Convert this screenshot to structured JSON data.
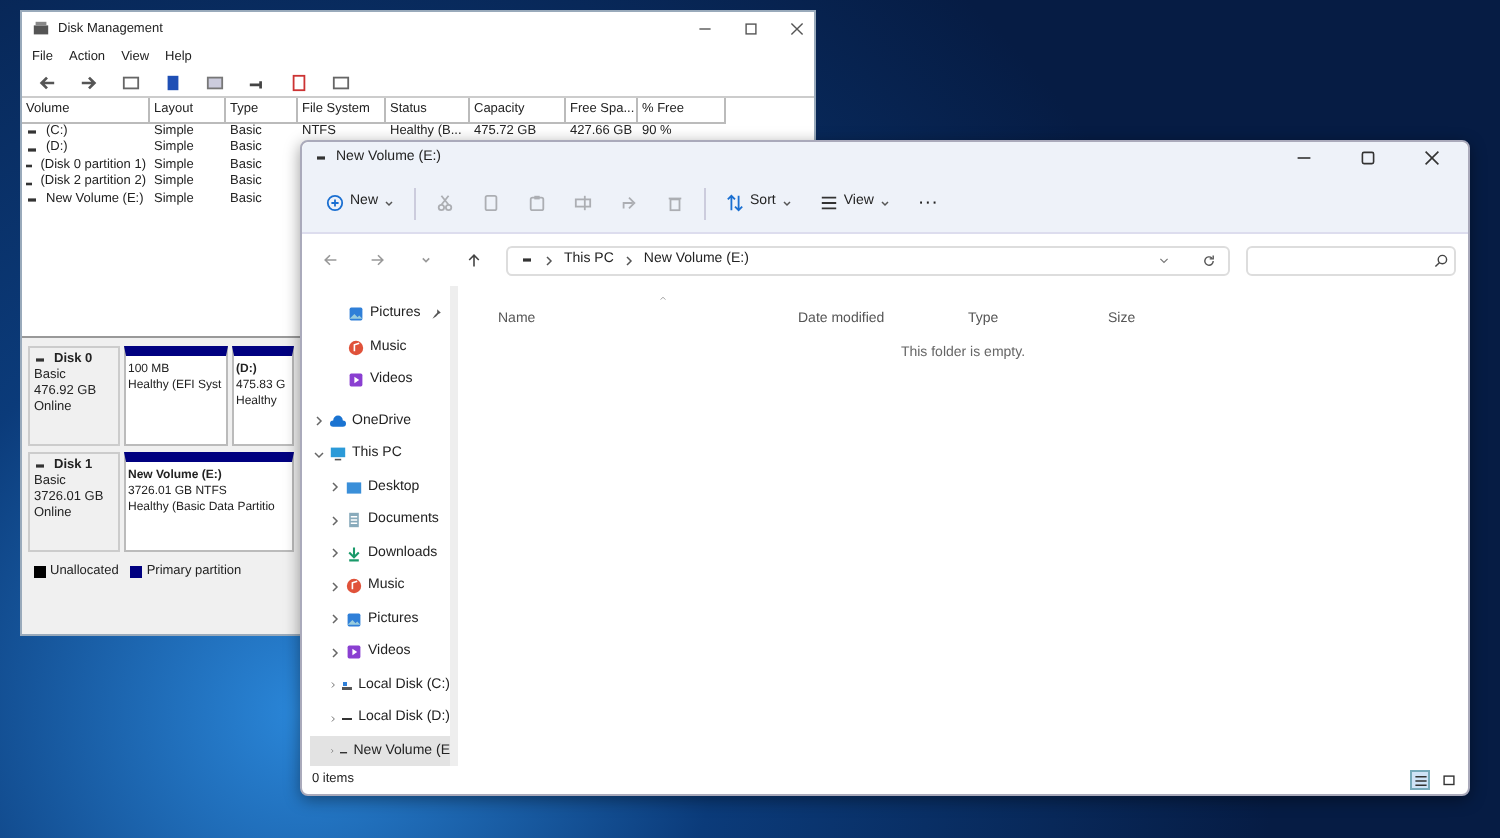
{
  "disk_management": {
    "title": "Disk Management",
    "menu": [
      "File",
      "Action",
      "View",
      "Help"
    ],
    "volumes": {
      "columns": [
        "Volume",
        "Layout",
        "Type",
        "File System",
        "Status",
        "Capacity",
        "Free Spa...",
        "% Free"
      ],
      "rows": [
        [
          "(C:)",
          "Simple",
          "Basic",
          "NTFS",
          "Healthy (B...",
          "475.72 GB",
          "427.66 GB",
          "90 %"
        ],
        [
          "(D:)",
          "Simple",
          "Basic"
        ],
        [
          "(Disk 0 partition 1)",
          "Simple",
          "Basic"
        ],
        [
          "(Disk 2 partition 2)",
          "Simple",
          "Basic"
        ],
        [
          "New Volume (E:)",
          "Simple",
          "Basic"
        ]
      ]
    },
    "disks": [
      {
        "name": "Disk 0",
        "type": "Basic",
        "size": "476.92 GB",
        "status": "Online",
        "partitions": [
          {
            "details": [
              "100 MB",
              "Healthy (EFI Syst"
            ]
          },
          {
            "name": "(D:)",
            "details": [
              "475.83 G",
              "Healthy"
            ]
          }
        ]
      },
      {
        "name": "Disk 1",
        "type": "Basic",
        "size": "3726.01 GB",
        "status": "Online",
        "partitions": [
          {
            "name": "New Volume (E:)",
            "details": [
              "3726.01 GB NTFS",
              "Healthy (Basic Data Partitio"
            ]
          }
        ]
      }
    ],
    "legend": [
      {
        "label": "Unallocated",
        "color": "#000000"
      },
      {
        "label": "Primary partition",
        "color": "#000080"
      }
    ]
  },
  "explorer": {
    "title": "New Volume (E:)",
    "toolbar": [
      {
        "kind": "new",
        "label": "New",
        "disabled": false
      },
      {
        "kind": "cut",
        "disabled": true
      },
      {
        "kind": "copy",
        "disabled": true
      },
      {
        "kind": "paste",
        "disabled": true
      },
      {
        "kind": "rename",
        "disabled": true
      },
      {
        "kind": "share",
        "disabled": true
      },
      {
        "kind": "delete",
        "disabled": true
      },
      {
        "kind": "sort",
        "label": "Sort",
        "disabled": false
      },
      {
        "kind": "view",
        "label": "View",
        "disabled": false
      },
      {
        "kind": "more",
        "label": "···",
        "disabled": false
      }
    ],
    "breadcrumb": [
      "This PC",
      "New Volume (E:)"
    ],
    "navigation": [
      {
        "label": "Pictures",
        "kind": "pictures",
        "pinned": true,
        "selected": false
      },
      {
        "label": "Music",
        "kind": "music",
        "pinned": false,
        "selected": false
      },
      {
        "label": "Videos",
        "kind": "videos",
        "pinned": false,
        "selected": false
      },
      {
        "label": "OneDrive",
        "kind": "cloud",
        "expanded": false,
        "selected": false
      },
      {
        "label": "This PC",
        "kind": "computer",
        "expanded": true,
        "selected": false,
        "children": [
          {
            "label": "Desktop",
            "kind": "desktop",
            "expanded": false,
            "selected": false
          },
          {
            "label": "Documents",
            "kind": "documents",
            "expanded": false,
            "selected": false
          },
          {
            "label": "Downloads",
            "kind": "downloads",
            "expanded": false,
            "selected": false
          },
          {
            "label": "Music",
            "kind": "music",
            "expanded": false,
            "selected": false
          },
          {
            "label": "Pictures",
            "kind": "pictures",
            "expanded": false,
            "selected": false
          },
          {
            "label": "Videos",
            "kind": "videos",
            "expanded": false,
            "selected": false
          },
          {
            "label": "Local Disk (C:)",
            "kind": "system-drive",
            "expanded": false,
            "selected": false
          },
          {
            "label": "Local Disk (D:)",
            "kind": "drive",
            "expanded": false,
            "selected": false
          },
          {
            "label": "New Volume (E",
            "kind": "drive",
            "expanded": false,
            "selected": true
          }
        ]
      }
    ],
    "columns": [
      "Name",
      "Date modified",
      "Type",
      "Size"
    ],
    "empty_message": "This folder is empty.",
    "status": "0 items",
    "view_buttons": [
      {
        "kind": "details",
        "selected": true
      },
      {
        "kind": "tiles",
        "selected": false
      }
    ]
  }
}
